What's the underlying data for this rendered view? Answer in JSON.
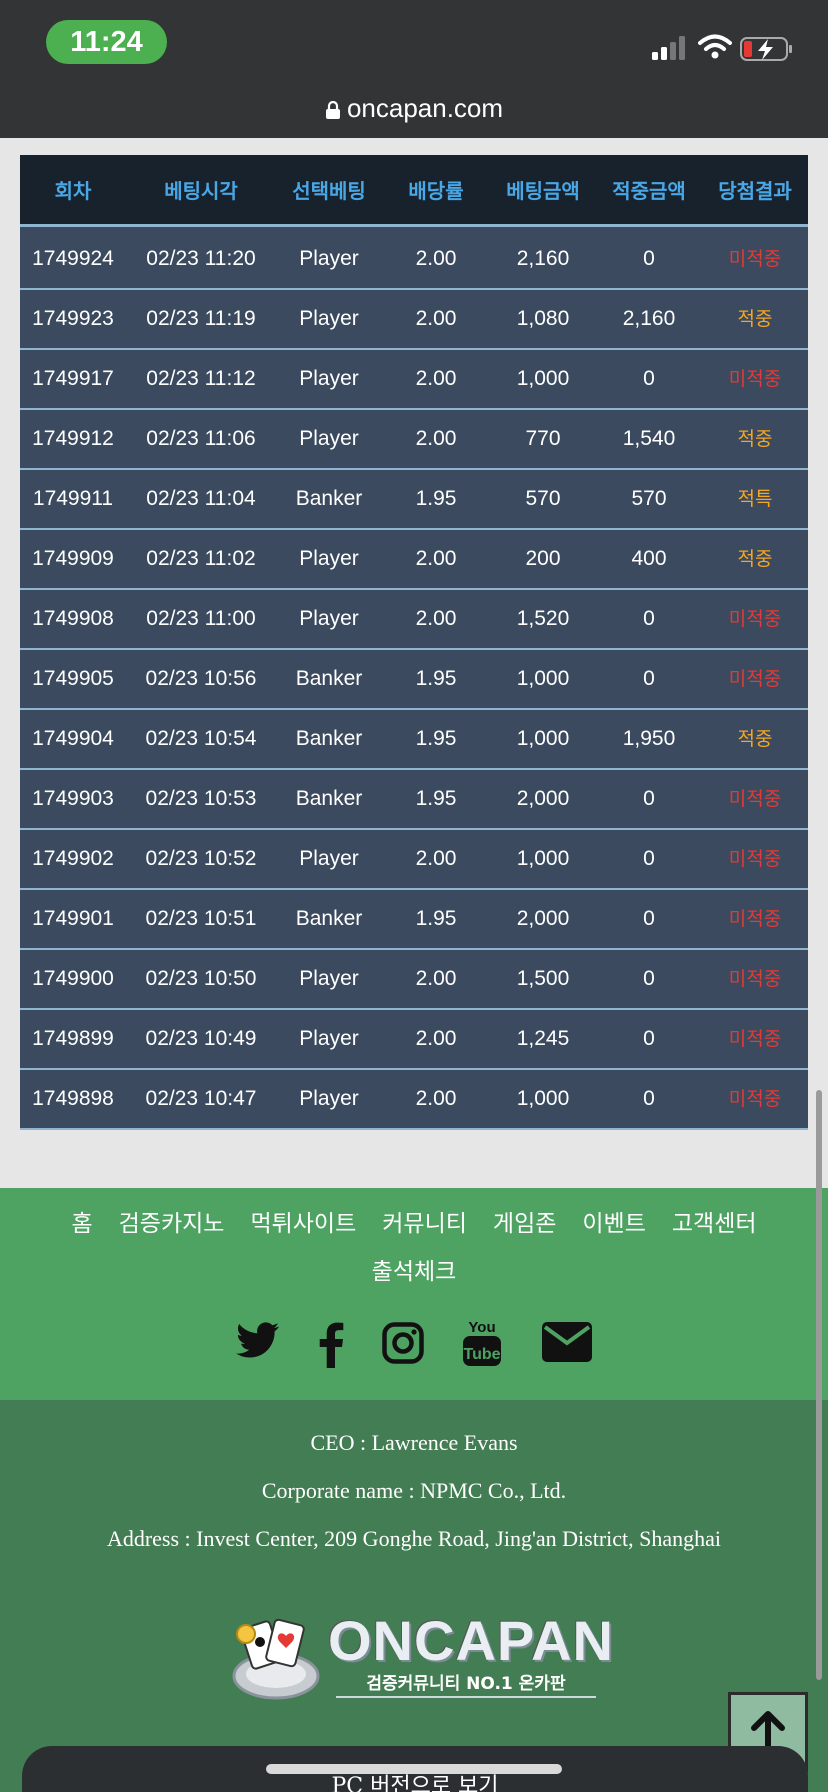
{
  "status": {
    "time": "11:24"
  },
  "browser": {
    "url": "oncapan.com"
  },
  "table": {
    "headers": [
      "회차",
      "베팅시각",
      "선택베팅",
      "배당률",
      "베팅금액",
      "적중금액",
      "당첨결과"
    ],
    "rows": [
      [
        "1749924",
        "02/23 11:20",
        "Player",
        "2.00",
        "2,160",
        "0",
        "미적중"
      ],
      [
        "1749923",
        "02/23 11:19",
        "Player",
        "2.00",
        "1,080",
        "2,160",
        "적중"
      ],
      [
        "1749917",
        "02/23 11:12",
        "Player",
        "2.00",
        "1,000",
        "0",
        "미적중"
      ],
      [
        "1749912",
        "02/23 11:06",
        "Player",
        "2.00",
        "770",
        "1,540",
        "적중"
      ],
      [
        "1749911",
        "02/23 11:04",
        "Banker",
        "1.95",
        "570",
        "570",
        "적특"
      ],
      [
        "1749909",
        "02/23 11:02",
        "Player",
        "2.00",
        "200",
        "400",
        "적중"
      ],
      [
        "1749908",
        "02/23 11:00",
        "Player",
        "2.00",
        "1,520",
        "0",
        "미적중"
      ],
      [
        "1749905",
        "02/23 10:56",
        "Banker",
        "1.95",
        "1,000",
        "0",
        "미적중"
      ],
      [
        "1749904",
        "02/23 10:54",
        "Banker",
        "1.95",
        "1,000",
        "1,950",
        "적중"
      ],
      [
        "1749903",
        "02/23 10:53",
        "Banker",
        "1.95",
        "2,000",
        "0",
        "미적중"
      ],
      [
        "1749902",
        "02/23 10:52",
        "Player",
        "2.00",
        "1,000",
        "0",
        "미적중"
      ],
      [
        "1749901",
        "02/23 10:51",
        "Banker",
        "1.95",
        "2,000",
        "0",
        "미적중"
      ],
      [
        "1749900",
        "02/23 10:50",
        "Player",
        "2.00",
        "1,500",
        "0",
        "미적중"
      ],
      [
        "1749899",
        "02/23 10:49",
        "Player",
        "2.00",
        "1,245",
        "0",
        "미적중"
      ],
      [
        "1749898",
        "02/23 10:47",
        "Player",
        "2.00",
        "1,000",
        "0",
        "미적중"
      ]
    ]
  },
  "footer": {
    "nav": [
      "홈",
      "검증카지노",
      "먹튀사이트",
      "커뮤니티",
      "게임존",
      "이벤트",
      "고객센터"
    ],
    "nav2": "출석체크",
    "socials": [
      "twitter-icon",
      "facebook-icon",
      "instagram-icon",
      "youtube-icon",
      "email-icon"
    ],
    "ceo": "CEO : Lawrence Evans",
    "corp": "Corporate name : NPMC Co., Ltd.",
    "address": "Address : Invest Center, 209 Gonghe Road, Jing'an District, Shanghai",
    "logo_text": "ONCAPAN",
    "logo_sub": "검증커뮤니티 NO.1 온카판",
    "pc_view": "PC 버전으로 보기"
  },
  "colors": {
    "win": "#f5a623",
    "lose": "#e53935",
    "header_text": "#4aa7e6",
    "footer_green": "#4ea363",
    "info_green": "#437d53"
  }
}
